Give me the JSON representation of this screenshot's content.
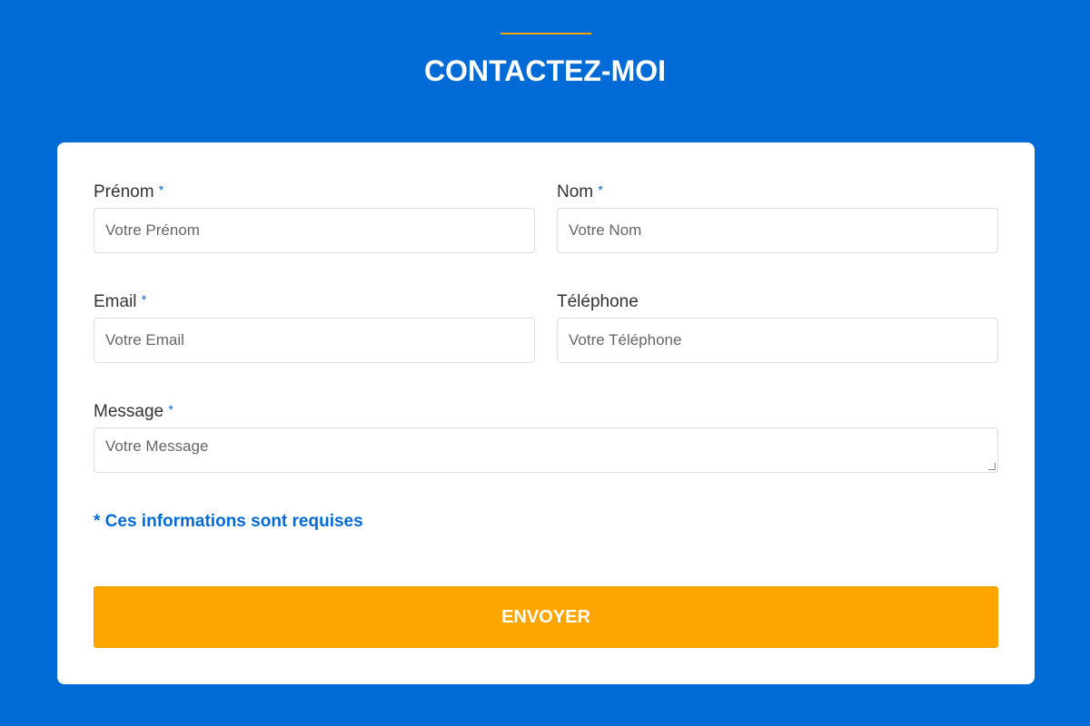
{
  "header": {
    "title": "CONTACTEZ-MOI"
  },
  "form": {
    "required_mark": "*",
    "fields": [
      {
        "label": "Prénom",
        "placeholder": "Votre Prénom",
        "required": true
      },
      {
        "label": "Nom",
        "placeholder": "Votre Nom",
        "required": true
      },
      {
        "label": "Email",
        "placeholder": "Votre Email",
        "required": true
      },
      {
        "label": "Téléphone",
        "placeholder": "Votre Téléphone",
        "required": false
      },
      {
        "label": "Message",
        "placeholder": "Votre Message",
        "required": true
      }
    ],
    "required_note": "* Ces informations sont requises",
    "submit_label": "ENVOYER"
  },
  "colors": {
    "background": "#006bd6",
    "accent": "#ffa500"
  }
}
